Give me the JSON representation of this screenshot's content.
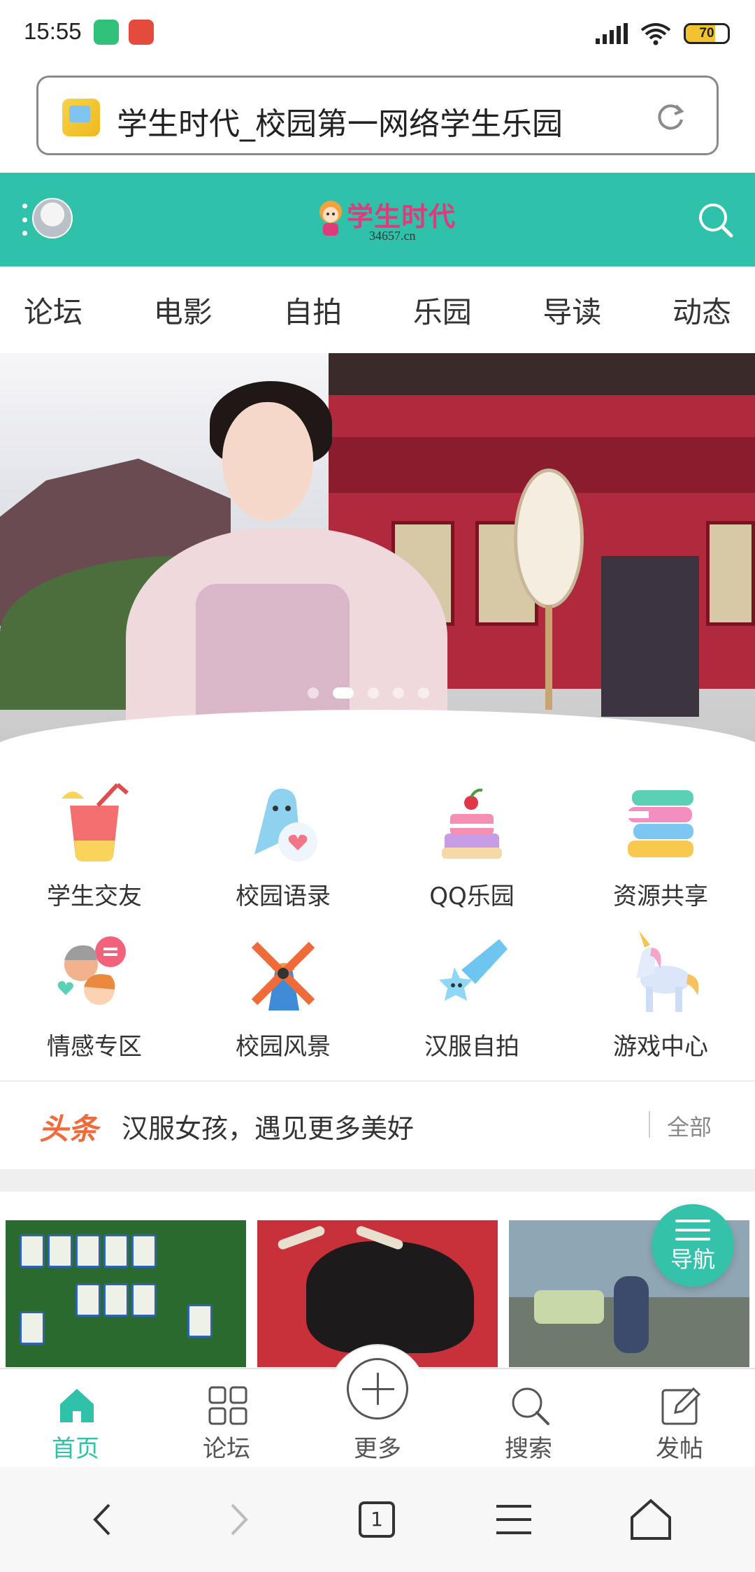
{
  "status_bar": {
    "time": "15:55",
    "battery_level": 70,
    "battery_text": "70",
    "battery_color": "#f2c230"
  },
  "address_bar": {
    "title": "学生时代_校园第一网络学生乐园",
    "icons": {
      "favicon": "site-favicon",
      "reload": "reload-icon"
    }
  },
  "header": {
    "logo_text": "学生时代",
    "logo_domain": "34657.cn",
    "accent_color": "#2fc1a9",
    "icons": {
      "menu": "menu-dots-icon",
      "avatar": "avatar",
      "search": "search-icon"
    }
  },
  "nav_tabs": [
    "论坛",
    "电影",
    "自拍",
    "乐园",
    "导读",
    "动态"
  ],
  "banner": {
    "slide_count": 5,
    "active_slide": 2
  },
  "grid_items": [
    {
      "label": "学生交友",
      "icon": "drink-icon"
    },
    {
      "label": "校园语录",
      "icon": "ghost-heart-icon"
    },
    {
      "label": "QQ乐园",
      "icon": "cake-icon"
    },
    {
      "label": "资源共享",
      "icon": "books-icon"
    },
    {
      "label": "情感专区",
      "icon": "couple-icon"
    },
    {
      "label": "校园风景",
      "icon": "windmill-icon"
    },
    {
      "label": "汉服自拍",
      "icon": "shooting-star-icon"
    },
    {
      "label": "游戏中心",
      "icon": "unicorn-icon"
    }
  ],
  "headline": {
    "tag": "头条",
    "text": "汉服女孩，遇见更多美好",
    "all_label": "全部",
    "tag_color": "#f06a3a"
  },
  "float_nav": {
    "label": "导航",
    "icon": "menu-lines-icon"
  },
  "bottom_tabs": [
    {
      "label": "首页",
      "icon": "home-icon",
      "active": true
    },
    {
      "label": "论坛",
      "icon": "grid-icon",
      "active": false
    },
    {
      "label": "更多",
      "icon": "plus-circle-icon",
      "active": false
    },
    {
      "label": "搜索",
      "icon": "search-icon",
      "active": false
    },
    {
      "label": "发帖",
      "icon": "edit-icon",
      "active": false
    }
  ],
  "browser_bar": {
    "tab_count": "1",
    "icons": [
      "back-icon",
      "forward-icon",
      "tabs-icon",
      "menu-icon",
      "home-icon"
    ]
  }
}
